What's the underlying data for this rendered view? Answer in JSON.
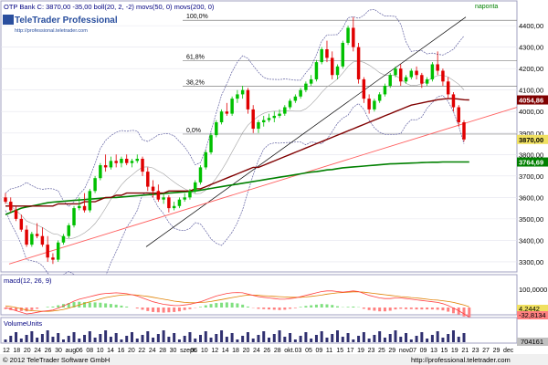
{
  "header": {
    "info": "OTP Bank C: 3870,00 -35,00 boll(20, 2, -2) movs(50, 0) movs(200, 0)",
    "period": "napontа"
  },
  "logo": {
    "brand": "TeleTrader Professional",
    "url": "http://professional.teletrader.com"
  },
  "footer": {
    "copyright": "© 2012 TeleTrader Software GmbH",
    "url": "http://professional.teletrader.com"
  },
  "colors": {
    "up_candle": "#00c000",
    "down_candle": "#e00000",
    "bollinger": "#6060a0",
    "ma50": "#800000",
    "ma200": "#008000",
    "trend_black": "#000000",
    "trend_red": "#ff6060",
    "price_tag": "#f0e060",
    "panel_border": "#a0a0c0"
  },
  "fib_labels": [
    "100,0%",
    "61,8%",
    "38,2%",
    "0,0%"
  ],
  "price_tags": {
    "last": "3870,00",
    "ma50": "4054,86",
    "ma200": "3764,69"
  },
  "macd": {
    "title": "macd(12, 26, 9)",
    "axis_labels": [
      "100,0000",
      "4,2442",
      "-32,8134"
    ]
  },
  "volume": {
    "title": "VolumeUnits",
    "axis_label": "704161"
  },
  "chart_data": {
    "type": "candlestick",
    "y_ticks": [
      "4400,00",
      "4300,00",
      "4200,00",
      "4100,00",
      "4000,00",
      "3900,00",
      "3800,00",
      "3700,00",
      "3600,00",
      "3500,00",
      "3400,00",
      "3300,00"
    ],
    "ylim": [
      3270,
      4460
    ],
    "x_ticks": [
      "12",
      "18",
      "20",
      "24",
      "26",
      "30",
      "aug.",
      "06",
      "08",
      "10",
      "14",
      "16",
      "20",
      "22",
      "24",
      "28",
      "30",
      "szept.",
      "06",
      "10",
      "12",
      "14",
      "18",
      "20",
      "24",
      "26",
      "28",
      "okt.",
      "03",
      "05",
      "09",
      "11",
      "15",
      "17",
      "19",
      "23",
      "25",
      "29",
      "nov.",
      "07",
      "09",
      "13",
      "15",
      "19",
      "21",
      "23",
      "27",
      "29",
      "dec"
    ],
    "candles": [
      [
        3600,
        3620,
        3580,
        3570
      ],
      [
        3580,
        3600,
        3540,
        3530
      ],
      [
        3540,
        3560,
        3500,
        3490
      ],
      [
        3500,
        3520,
        3450,
        3440
      ],
      [
        3450,
        3470,
        3380,
        3370
      ],
      [
        3380,
        3440,
        3430,
        3370
      ],
      [
        3430,
        3480,
        3420,
        3410
      ],
      [
        3420,
        3460,
        3380,
        3370
      ],
      [
        3380,
        3420,
        3320,
        3300
      ],
      [
        3320,
        3340,
        3310,
        3290
      ],
      [
        3310,
        3400,
        3390,
        3300
      ],
      [
        3390,
        3430,
        3420,
        3380
      ],
      [
        3420,
        3480,
        3470,
        3410
      ],
      [
        3470,
        3560,
        3550,
        3460
      ],
      [
        3550,
        3600,
        3560,
        3540
      ],
      [
        3560,
        3620,
        3540,
        3530
      ],
      [
        3540,
        3640,
        3630,
        3530
      ],
      [
        3630,
        3700,
        3690,
        3620
      ],
      [
        3690,
        3760,
        3750,
        3680
      ],
      [
        3750,
        3800,
        3740,
        3720
      ],
      [
        3740,
        3790,
        3770,
        3730
      ],
      [
        3770,
        3800,
        3760,
        3740
      ],
      [
        3760,
        3790,
        3780,
        3740
      ],
      [
        3780,
        3800,
        3760,
        3750
      ],
      [
        3760,
        3780,
        3770,
        3740
      ],
      [
        3770,
        3800,
        3780,
        3760
      ],
      [
        3780,
        3790,
        3720,
        3700
      ],
      [
        3720,
        3740,
        3650,
        3630
      ],
      [
        3650,
        3680,
        3630,
        3600
      ],
      [
        3630,
        3660,
        3590,
        3580
      ],
      [
        3590,
        3620,
        3600,
        3570
      ],
      [
        3600,
        3610,
        3550,
        3530
      ],
      [
        3550,
        3580,
        3560,
        3540
      ],
      [
        3560,
        3600,
        3590,
        3550
      ],
      [
        3590,
        3620,
        3600,
        3580
      ],
      [
        3600,
        3640,
        3630,
        3590
      ],
      [
        3630,
        3680,
        3670,
        3620
      ],
      [
        3670,
        3750,
        3740,
        3660
      ],
      [
        3740,
        3820,
        3810,
        3730
      ],
      [
        3810,
        3900,
        3890,
        3800
      ],
      [
        3890,
        3960,
        3950,
        3880
      ],
      [
        3950,
        4010,
        4000,
        3940
      ],
      [
        4000,
        4040,
        3990,
        3980
      ],
      [
        3990,
        4070,
        4060,
        3980
      ],
      [
        4060,
        4100,
        4080,
        4040
      ],
      [
        4080,
        4120,
        4100,
        4060
      ],
      [
        4100,
        4110,
        4010,
        3990
      ],
      [
        4010,
        4030,
        3920,
        3900
      ],
      [
        3920,
        3960,
        3950,
        3900
      ],
      [
        3950,
        3980,
        3960,
        3930
      ],
      [
        3960,
        3990,
        3970,
        3950
      ],
      [
        3970,
        4000,
        3980,
        3950
      ],
      [
        3980,
        4010,
        3990,
        3970
      ],
      [
        3990,
        4030,
        4020,
        3980
      ],
      [
        4020,
        4060,
        4050,
        4010
      ],
      [
        4050,
        4080,
        4070,
        4040
      ],
      [
        4070,
        4110,
        4100,
        4060
      ],
      [
        4100,
        4140,
        4130,
        4090
      ],
      [
        4130,
        4170,
        4150,
        4120
      ],
      [
        4150,
        4240,
        4230,
        4140
      ],
      [
        4230,
        4300,
        4290,
        4220
      ],
      [
        4290,
        4330,
        4250,
        4230
      ],
      [
        4250,
        4280,
        4170,
        4150
      ],
      [
        4170,
        4220,
        4210,
        4150
      ],
      [
        4210,
        4330,
        4320,
        4200
      ],
      [
        4320,
        4400,
        4390,
        4310
      ],
      [
        4390,
        4440,
        4300,
        4280
      ],
      [
        4300,
        4320,
        4150,
        4130
      ],
      [
        4150,
        4160,
        4060,
        4040
      ],
      [
        4060,
        4080,
        4010,
        3990
      ],
      [
        4010,
        4060,
        4050,
        4000
      ],
      [
        4050,
        4090,
        4080,
        4040
      ],
      [
        4080,
        4130,
        4120,
        4070
      ],
      [
        4120,
        4180,
        4170,
        4110
      ],
      [
        4170,
        4210,
        4200,
        4160
      ],
      [
        4200,
        4220,
        4140,
        4120
      ],
      [
        4140,
        4170,
        4160,
        4130
      ],
      [
        4160,
        4200,
        4190,
        4150
      ],
      [
        4190,
        4210,
        4170,
        4150
      ],
      [
        4170,
        4180,
        4130,
        4110
      ],
      [
        4130,
        4160,
        4150,
        4120
      ],
      [
        4150,
        4230,
        4220,
        4140
      ],
      [
        4220,
        4280,
        4190,
        4170
      ],
      [
        4190,
        4200,
        4140,
        4120
      ],
      [
        4140,
        4160,
        4080,
        4060
      ],
      [
        4080,
        4090,
        4020,
        4000
      ],
      [
        4020,
        4030,
        3950,
        3930
      ],
      [
        3950,
        3960,
        3870,
        3860
      ]
    ],
    "ma50": [
      3560,
      3560,
      3560,
      3560,
      3560,
      3560,
      3560,
      3560,
      3560,
      3560,
      3570,
      3570,
      3570,
      3570,
      3570,
      3580,
      3580,
      3580,
      3590,
      3600,
      3600,
      3610,
      3610,
      3620,
      3620,
      3620,
      3620,
      3620,
      3620,
      3620,
      3620,
      3630,
      3630,
      3630,
      3630,
      3630,
      3640,
      3640,
      3650,
      3660,
      3670,
      3680,
      3690,
      3700,
      3710,
      3720,
      3730,
      3740,
      3740,
      3750,
      3760,
      3770,
      3780,
      3790,
      3800,
      3810,
      3820,
      3830,
      3840,
      3850,
      3860,
      3870,
      3880,
      3890,
      3900,
      3910,
      3920,
      3930,
      3940,
      3950,
      3960,
      3970,
      3980,
      3990,
      4000,
      4010,
      4020,
      4030,
      4035,
      4040,
      4045,
      4050,
      4055,
      4058,
      4060,
      4060,
      4058,
      4055,
      4054
    ],
    "ma200": [
      3520,
      3530,
      3540,
      3550,
      3555,
      3560,
      3565,
      3570,
      3575,
      3578,
      3580,
      3582,
      3584,
      3586,
      3588,
      3590,
      3592,
      3594,
      3596,
      3598,
      3600,
      3600,
      3602,
      3604,
      3606,
      3608,
      3610,
      3612,
      3614,
      3616,
      3618,
      3620,
      3622,
      3624,
      3626,
      3628,
      3630,
      3634,
      3638,
      3642,
      3646,
      3650,
      3654,
      3658,
      3662,
      3666,
      3670,
      3674,
      3678,
      3682,
      3686,
      3690,
      3694,
      3698,
      3702,
      3706,
      3710,
      3714,
      3718,
      3720,
      3724,
      3728,
      3730,
      3734,
      3738,
      3740,
      3742,
      3744,
      3746,
      3748,
      3750,
      3752,
      3754,
      3756,
      3757,
      3758,
      3759,
      3760,
      3761,
      3762,
      3763,
      3764,
      3764,
      3765,
      3765,
      3765,
      3765,
      3765,
      3765
    ],
    "macd_line": [
      0,
      -5,
      -10,
      -15,
      -20,
      -18,
      -15,
      -12,
      -10,
      -8,
      -2,
      5,
      12,
      20,
      26,
      30,
      34,
      38,
      42,
      44,
      45,
      46,
      45,
      43,
      40,
      36,
      30,
      24,
      18,
      14,
      10,
      8,
      6,
      6,
      8,
      10,
      14,
      18,
      24,
      30,
      36,
      40,
      44,
      46,
      47,
      46,
      42,
      38,
      34,
      32,
      30,
      28,
      26,
      26,
      28,
      30,
      34,
      38,
      42,
      46,
      50,
      52,
      52,
      50,
      48,
      50,
      52,
      50,
      44,
      38,
      34,
      30,
      28,
      28,
      30,
      30,
      28,
      26,
      24,
      22,
      20,
      18,
      16,
      12,
      6,
      -2,
      -10,
      -20,
      -30
    ],
    "macd_signal": [
      5,
      3,
      0,
      -4,
      -8,
      -10,
      -11,
      -12,
      -12,
      -11,
      -9,
      -6,
      -2,
      3,
      8,
      13,
      18,
      22,
      27,
      31,
      34,
      37,
      39,
      40,
      40,
      39,
      37,
      35,
      32,
      29,
      26,
      23,
      20,
      18,
      16,
      15,
      15,
      16,
      17,
      19,
      22,
      25,
      28,
      31,
      34,
      37,
      39,
      39,
      38,
      37,
      36,
      35,
      34,
      33,
      32,
      32,
      32,
      33,
      35,
      37,
      39,
      42,
      44,
      46,
      47,
      48,
      49,
      49,
      48,
      46,
      44,
      42,
      40,
      38,
      36,
      34,
      33,
      31,
      30,
      28,
      26,
      24,
      23,
      21,
      19,
      16,
      12,
      8,
      2
    ]
  }
}
